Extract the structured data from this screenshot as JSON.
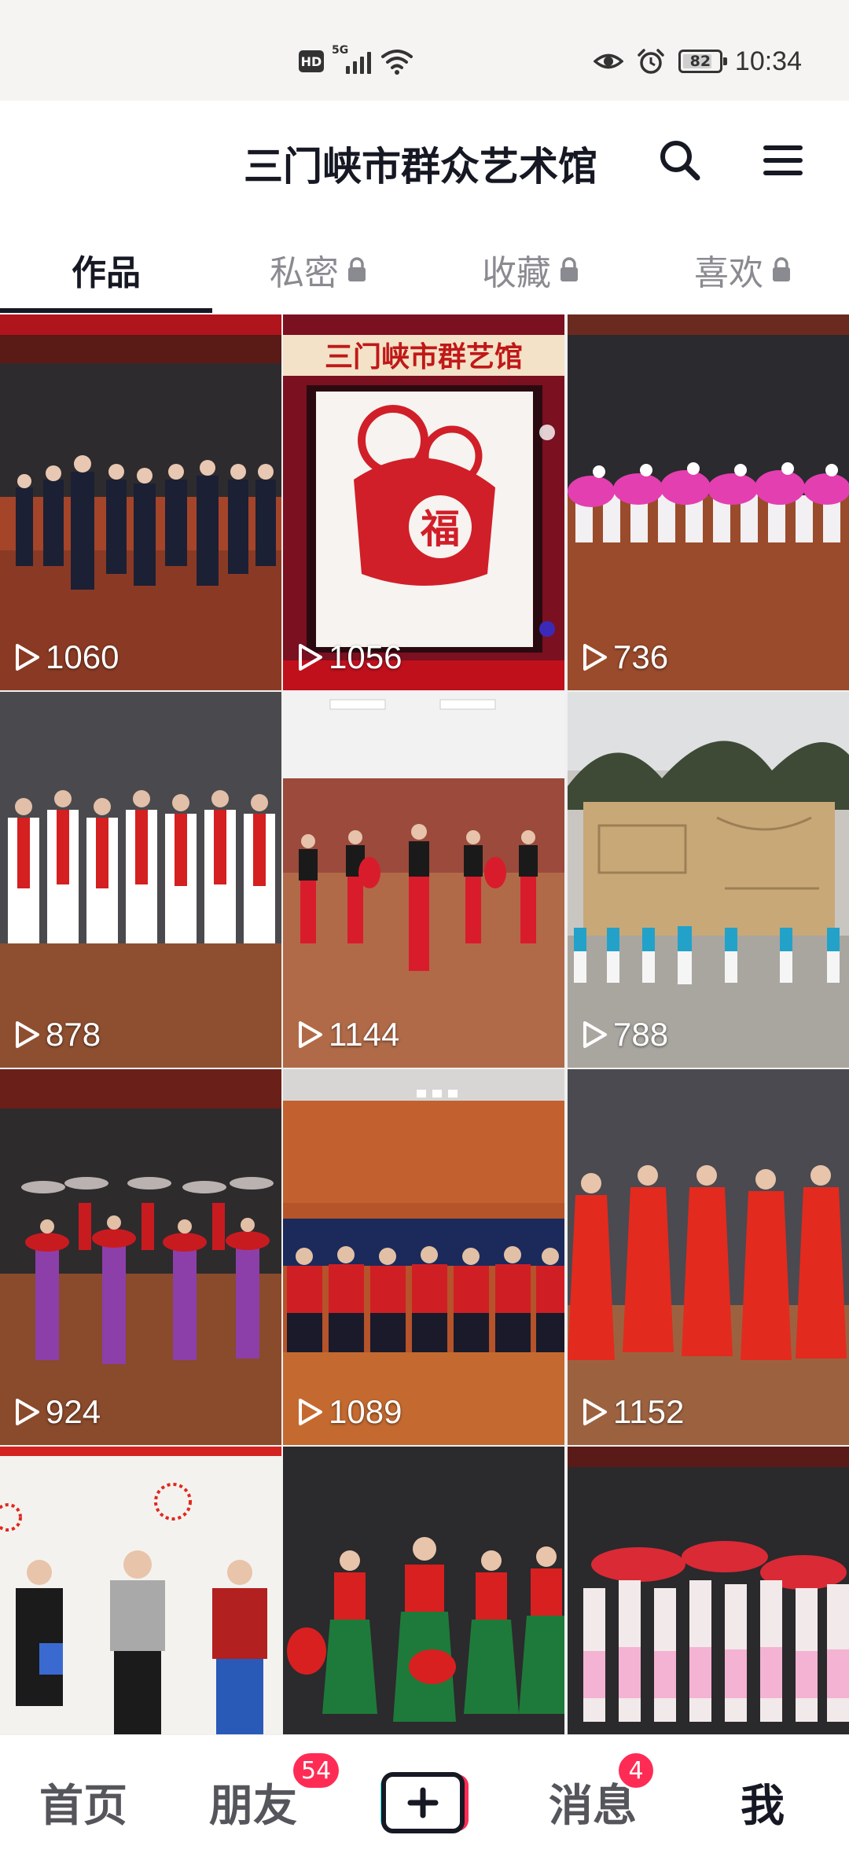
{
  "status_bar": {
    "hd": "HD",
    "network": "5G",
    "battery": "82",
    "battery_level": 0.82,
    "time": "10:34"
  },
  "header": {
    "title": "三门峡市群众艺术馆",
    "search_icon": "search-icon",
    "menu_icon": "menu-icon"
  },
  "tabs": [
    {
      "label": "作品",
      "locked": false,
      "active": true
    },
    {
      "label": "私密",
      "locked": true,
      "active": false
    },
    {
      "label": "收藏",
      "locked": true,
      "active": false
    },
    {
      "label": "喜欢",
      "locked": true,
      "active": false
    }
  ],
  "videos": [
    {
      "plays": "1060"
    },
    {
      "plays": "1056"
    },
    {
      "plays": "736"
    },
    {
      "plays": "878"
    },
    {
      "plays": "1144"
    },
    {
      "plays": "788"
    },
    {
      "plays": "924"
    },
    {
      "plays": "1089"
    },
    {
      "plays": "1152"
    },
    {
      "plays": ""
    },
    {
      "plays": ""
    },
    {
      "plays": ""
    }
  ],
  "thumbnail_text": {
    "banner": "三门峡市群艺馆",
    "fu": "福"
  },
  "bottom_nav": {
    "home": "首页",
    "friends": "朋友",
    "friends_badge": "54",
    "add": "+",
    "messages": "消息",
    "messages_badge": "4",
    "me": "我"
  },
  "colors": {
    "accent": "#fe2c55",
    "text": "#161823",
    "muted": "#8a8b91"
  }
}
